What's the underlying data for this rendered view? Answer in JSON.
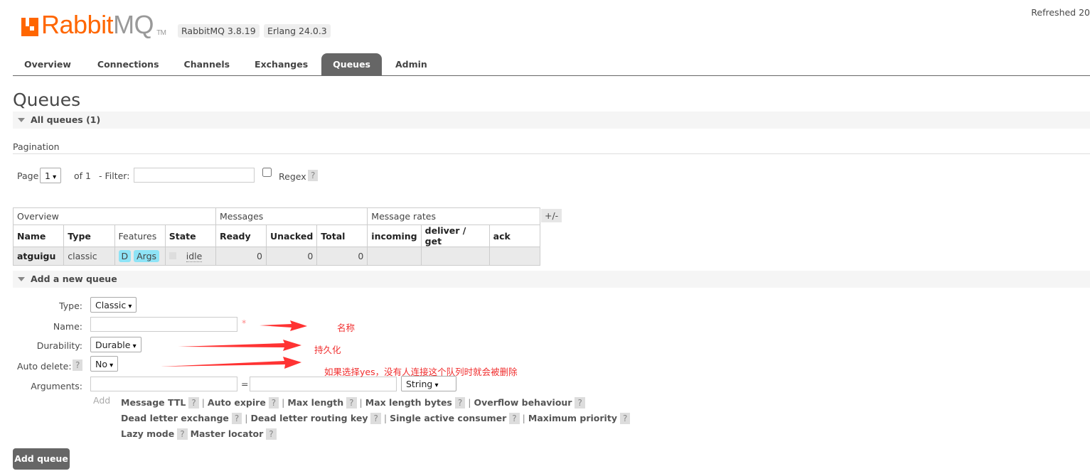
{
  "header": {
    "logo_brand": "Rabbit",
    "logo_mq": "MQ",
    "logo_tm": "TM",
    "version": "RabbitMQ 3.8.19",
    "erlang": "Erlang 24.0.3",
    "refreshed": "Refreshed 20"
  },
  "nav": {
    "tabs": [
      {
        "label": "Overview"
      },
      {
        "label": "Connections"
      },
      {
        "label": "Channels"
      },
      {
        "label": "Exchanges"
      },
      {
        "label": "Queues",
        "active": true
      },
      {
        "label": "Admin"
      }
    ]
  },
  "page": {
    "title": "Queues",
    "all_queues": "All queues (1)",
    "pagination": "Pagination"
  },
  "pager": {
    "page_label": "Page",
    "page_value": "1",
    "of": "of 1",
    "filter_label": "- Filter:",
    "filter_value": "",
    "regex": "Regex",
    "regex_checked": false,
    "help": "?"
  },
  "table": {
    "groups": [
      "Overview",
      "Messages",
      "Message rates"
    ],
    "toggle": "+/-",
    "columns": [
      "Name",
      "Type",
      "Features",
      "State",
      "Ready",
      "Unacked",
      "Total",
      "incoming",
      "deliver / get",
      "ack"
    ],
    "rows": [
      {
        "name": "atguigu",
        "type": "classic",
        "features": [
          "D",
          "Args"
        ],
        "state": "idle",
        "ready": "0",
        "unacked": "0",
        "total": "0",
        "incoming": "",
        "deliver_get": "",
        "ack": ""
      }
    ]
  },
  "add": {
    "title": "Add a new queue",
    "type_label": "Type:",
    "type_value": "Classic",
    "name_label": "Name:",
    "name_value": "",
    "required": "*",
    "durability_label": "Durability:",
    "durability_value": "Durable",
    "auto_delete_label": "Auto delete:",
    "auto_delete_value": "No",
    "arguments_label": "Arguments:",
    "arg_eq": "=",
    "arg_type": "String",
    "add_label": "Add",
    "options": [
      [
        "Message TTL",
        "Auto expire",
        "Max length",
        "Max length bytes",
        "Overflow behaviour"
      ],
      [
        "Dead letter exchange",
        "Dead letter routing key",
        "Single active consumer",
        "Maximum priority"
      ],
      [
        "Lazy mode",
        "Master locator"
      ]
    ],
    "button": "Add queue"
  },
  "annotations": {
    "name": "名称",
    "durability": "持久化",
    "auto_delete": "如果选择yes，没有人连接这个队列时就会被删除",
    "color": "#f02e2e"
  }
}
